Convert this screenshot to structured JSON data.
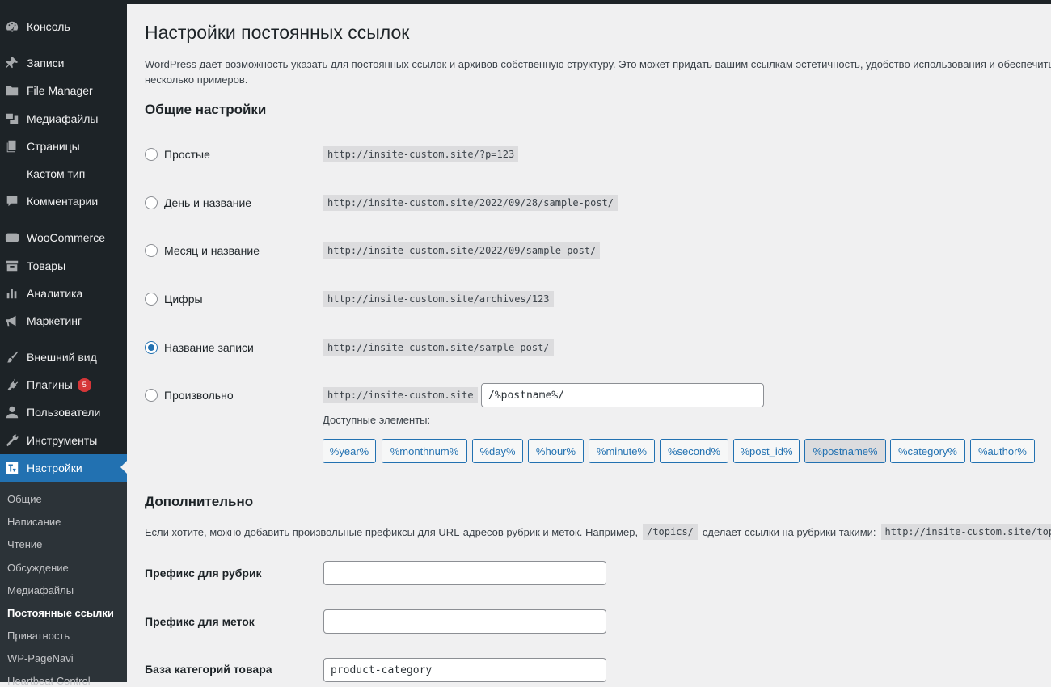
{
  "sidebar": {
    "items": [
      {
        "label": "Консоль",
        "icon": "dashboard-icon"
      },
      {
        "label": "Записи",
        "icon": "pin-icon"
      },
      {
        "label": "File Manager",
        "icon": "folder-icon"
      },
      {
        "label": "Медиафайлы",
        "icon": "media-icon"
      },
      {
        "label": "Страницы",
        "icon": "pages-icon"
      },
      {
        "label": "Кастом тип",
        "icon": ""
      },
      {
        "label": "Комментарии",
        "icon": "comment-icon"
      },
      {
        "label": "WooCommerce",
        "icon": "woo-icon"
      },
      {
        "label": "Товары",
        "icon": "archive-icon"
      },
      {
        "label": "Аналитика",
        "icon": "chart-icon"
      },
      {
        "label": "Маркетинг",
        "icon": "megaphone-icon"
      },
      {
        "label": "Внешний вид",
        "icon": "brush-icon"
      },
      {
        "label": "Плагины",
        "icon": "plugin-icon",
        "badge": "5"
      },
      {
        "label": "Пользователи",
        "icon": "user-icon"
      },
      {
        "label": "Инструменты",
        "icon": "wrench-icon"
      },
      {
        "label": "Настройки",
        "icon": "settings-icon"
      }
    ],
    "submenu": [
      {
        "label": "Общие"
      },
      {
        "label": "Написание"
      },
      {
        "label": "Чтение"
      },
      {
        "label": "Обсуждение"
      },
      {
        "label": "Медиафайлы"
      },
      {
        "label": "Постоянные ссылки"
      },
      {
        "label": "Приватность"
      },
      {
        "label": "WP-PageNavi"
      },
      {
        "label": "Heartbeat Control"
      }
    ]
  },
  "page": {
    "title": "Настройки постоянных ссылок",
    "intro_line1": "WordPress даёт возможность указать для постоянных ссылок и архивов собственную структуру. Это может придать вашим ссылкам эстетичность, удобство использования и обеспечить с",
    "intro_line2": "несколько примеров.",
    "common_heading": "Общие настройки",
    "options": [
      {
        "label": "Простые",
        "example": "http://insite-custom.site/?p=123"
      },
      {
        "label": "День и название",
        "example": "http://insite-custom.site/2022/09/28/sample-post/"
      },
      {
        "label": "Месяц и название",
        "example": "http://insite-custom.site/2022/09/sample-post/"
      },
      {
        "label": "Цифры",
        "example": "http://insite-custom.site/archives/123"
      },
      {
        "label": "Название записи",
        "example": "http://insite-custom.site/sample-post/"
      },
      {
        "label": "Произвольно",
        "example": "http://insite-custom.site"
      }
    ],
    "custom_structure_value": "/%postname%/",
    "available_label": "Доступные элементы:",
    "tags": [
      "%year%",
      "%monthnum%",
      "%day%",
      "%hour%",
      "%minute%",
      "%second%",
      "%post_id%",
      "%postname%",
      "%category%",
      "%author%"
    ],
    "optional_heading": "Дополнительно",
    "optional_text_before": "Если хотите, можно добавить произвольные префиксы для URL-адресов рубрик и меток. Например,",
    "optional_code": "/topics/",
    "optional_text_after": "сделает ссылки на рубрики такими:",
    "optional_code2": "http://insite-custom.site/topic",
    "category_base_label": "Префикс для рубрик",
    "category_base_value": "",
    "tag_base_label": "Префикс для меток",
    "tag_base_value": "",
    "product_category_label": "База категорий товара",
    "product_category_value": "product-category"
  }
}
